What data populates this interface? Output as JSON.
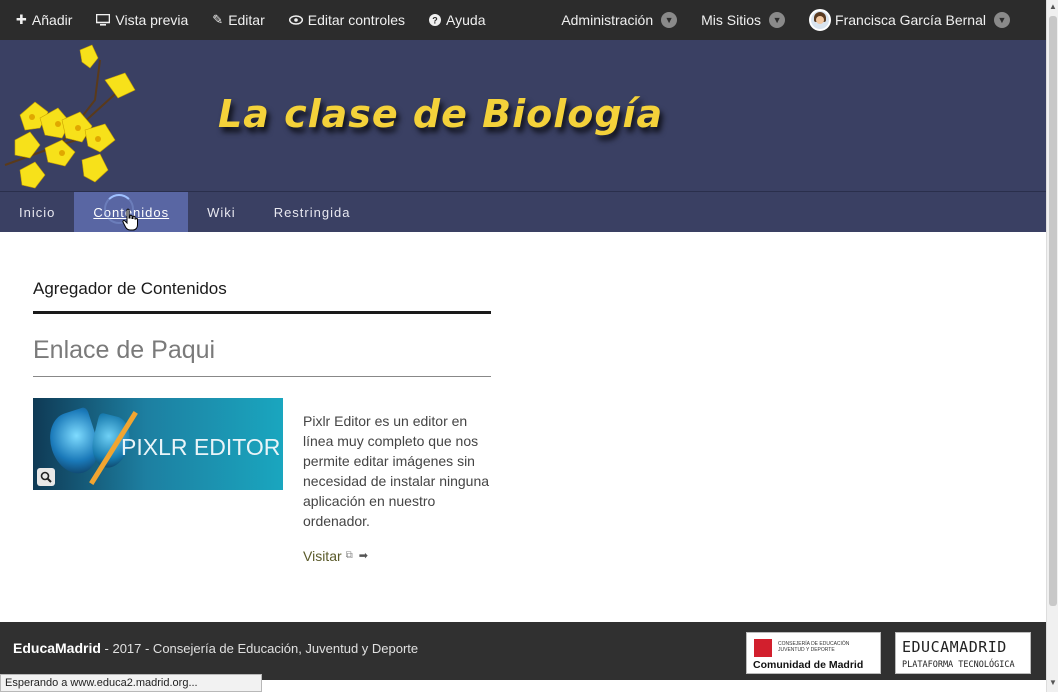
{
  "topbar": {
    "left_items": [
      {
        "label": "Añadir",
        "icon": "plus-icon"
      },
      {
        "label": "Vista previa",
        "icon": "monitor-icon"
      },
      {
        "label": "Editar",
        "icon": "edit-icon"
      },
      {
        "label": "Editar controles",
        "icon": "eye-icon"
      },
      {
        "label": "Ayuda",
        "icon": "question-icon"
      }
    ],
    "admin_label": "Administración",
    "sites_label": "Mis Sitios",
    "user_name": "Francisca García Bernal"
  },
  "banner": {
    "site_title": "La clase de Biología",
    "background": "#3a4063",
    "title_color": "#f4d23a"
  },
  "nav": {
    "tabs": [
      {
        "label": "Inicio",
        "active": false
      },
      {
        "label": "Contenidos",
        "active": true
      },
      {
        "label": "Wiki",
        "active": false
      },
      {
        "label": "Restringida",
        "active": false
      }
    ]
  },
  "main": {
    "portlet_title": "Agregador de Contenidos",
    "entry_title": "Enlace de Paqui",
    "thumbnail_text": "PIXLR EDITOR",
    "description": "Pixlr Editor es un editor en línea muy completo que nos permite editar imágenes sin necesidad de instalar ninguna aplicación en nuestro ordenador.",
    "visit_label": "Visitar"
  },
  "footer": {
    "brand": "EducaMadrid",
    "text": " - 2017 - Consejería de Educación, Juventud y Deporte",
    "logo_cm_small": "CONSEJERÍA DE EDUCACIÓN JUVENTUD Y DEPORTE",
    "logo_cm_name": "Comunidad de Madrid",
    "logo_em_name": "EDUCAMADRID",
    "logo_em_sub": "PLATAFORMA TECNOLÓGICA"
  },
  "status_bar": "Esperando a www.educa2.madrid.org..."
}
